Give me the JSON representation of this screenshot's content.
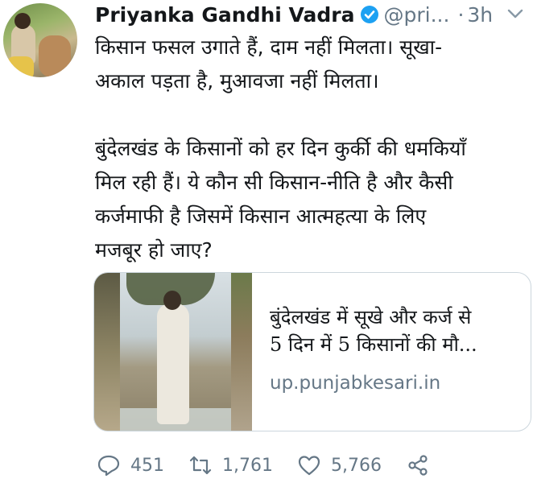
{
  "author": {
    "name": "Priyanka Gandhi Vadra",
    "handle": "@pri...",
    "separator": "·",
    "time": "3h"
  },
  "tweet": {
    "text": "किसान फसल उगाते हैं, दाम नहीं मिलता। सूखा-\nअकाल पड़ता है, मुआवजा नहीं मिलता।\n\nबुंदेलखंड के किसानों को हर दिन कुर्की की धमकियाँ\nमिल रही हैं। ये कौन सी किसान-नीति है और कैसी\nकर्जमाफी है जिसमें किसान आत्महत्या के लिए\nमजबूर हो जाए?"
  },
  "card": {
    "title_line1": "बुंदेलखंड में सूखे और कर्ज से",
    "title_line2": "5 दिन में 5 किसानों की मौ...",
    "domain": "up.punjabkesari.in"
  },
  "actions": {
    "replies": "451",
    "retweets": "1,761",
    "likes": "5,766"
  },
  "colors": {
    "verified": "#1da1f2",
    "secondary_text": "#657786",
    "border": "#ccd6dd"
  },
  "icons": [
    "verified-badge-icon",
    "chevron-down-icon",
    "reply-icon",
    "retweet-icon",
    "like-icon",
    "share-icon"
  ]
}
